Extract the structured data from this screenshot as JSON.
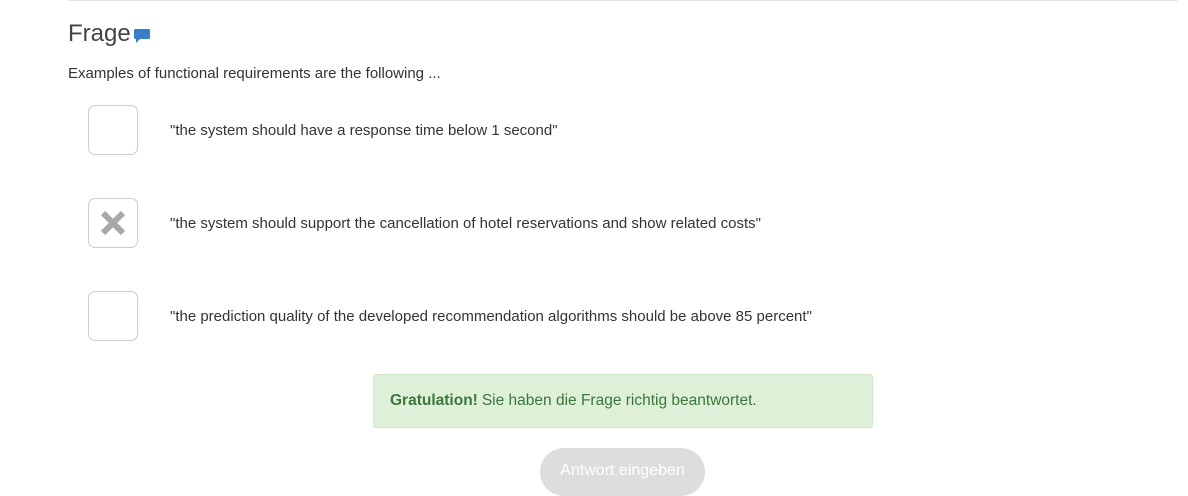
{
  "question": {
    "heading": "Frage",
    "heading_icon": "comment-icon",
    "text": "Examples of functional requirements are the following ..."
  },
  "options": [
    {
      "label": "\"the system should have a response time below 1 second\"",
      "checked": false
    },
    {
      "label": "\"the system should support the cancellation of hotel reservations and show related costs\"",
      "checked": true,
      "mark_icon": "x-mark-icon"
    },
    {
      "label": "\"the prediction quality of the developed recommendation algorithms should be above 85 percent\"",
      "checked": false
    }
  ],
  "feedback": {
    "strong": "Gratulation!",
    "message": "Sie haben die Frage richtig beantwortet."
  },
  "submit": {
    "label": "Antwort eingeben",
    "disabled": true
  },
  "colors": {
    "accent": "#3a7dc9",
    "success_bg": "#dff0d8",
    "success_text": "#3c763d",
    "mark": "#a8a8a8"
  }
}
